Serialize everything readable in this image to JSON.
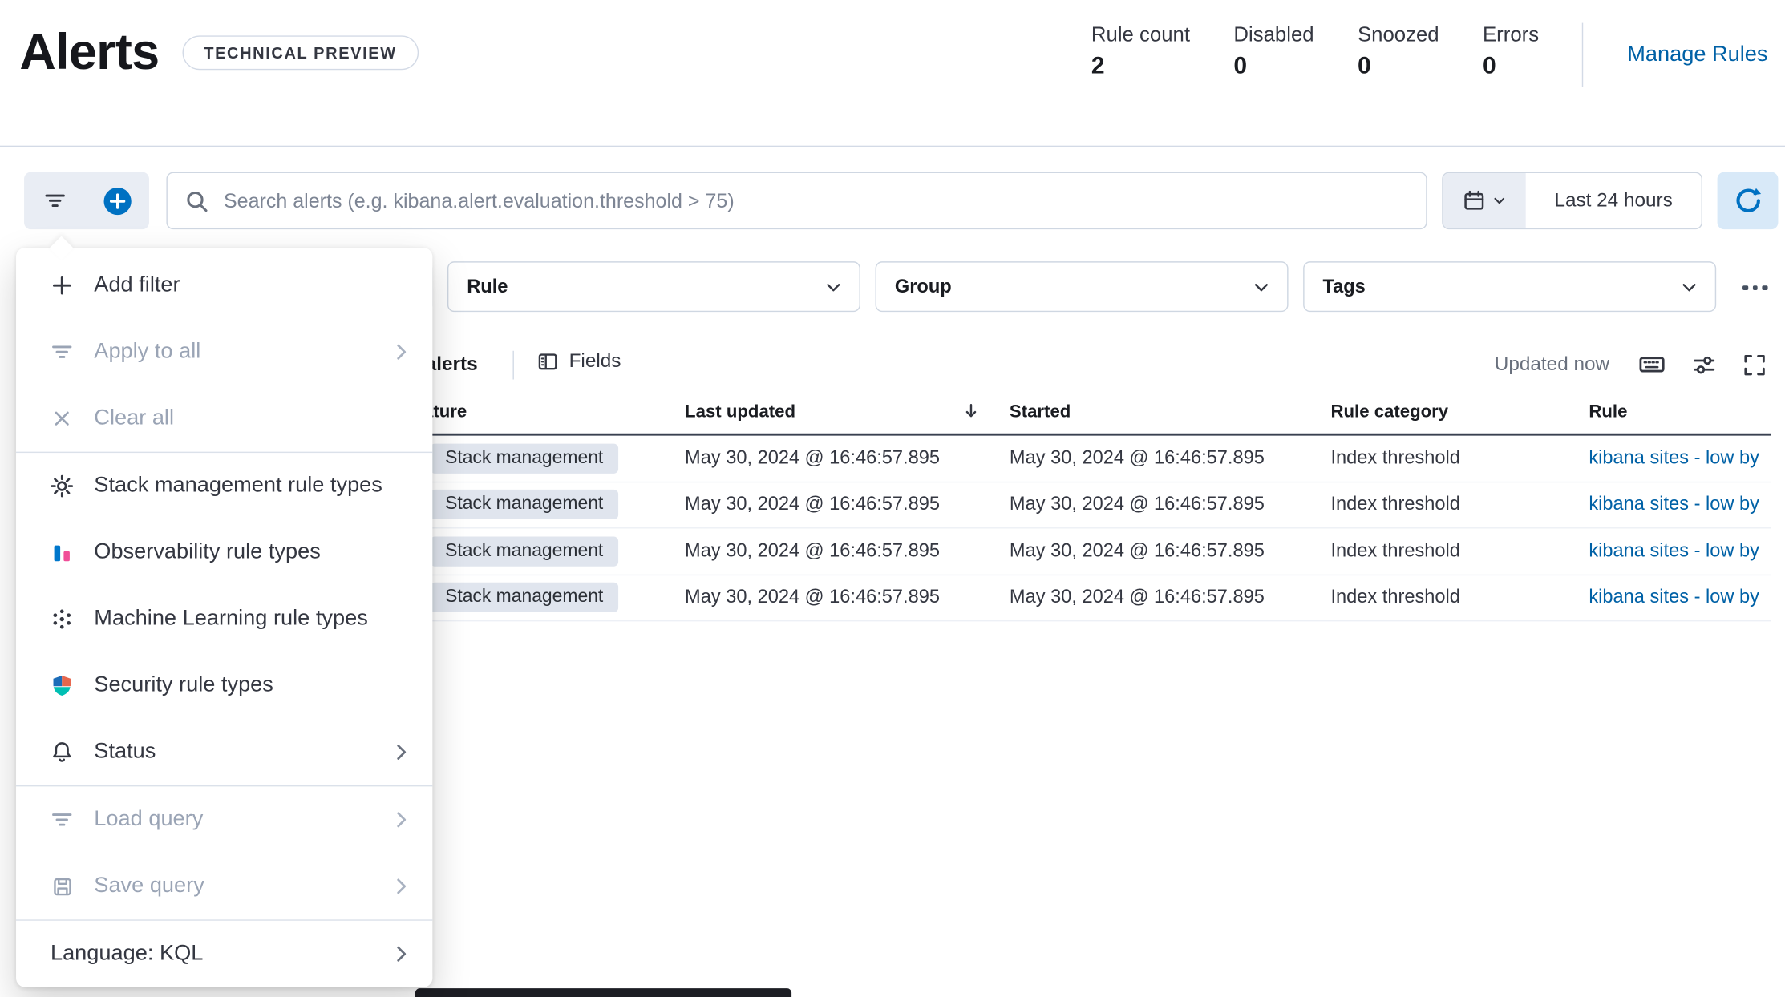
{
  "header": {
    "title": "Alerts",
    "tech_preview_badge": "TECHNICAL PREVIEW",
    "stats": [
      {
        "label": "Rule count",
        "value": "2"
      },
      {
        "label": "Disabled",
        "value": "0"
      },
      {
        "label": "Snoozed",
        "value": "0"
      },
      {
        "label": "Errors",
        "value": "0"
      }
    ],
    "manage_rules_link": "Manage Rules"
  },
  "search_bar": {
    "placeholder": "Search alerts (e.g. kibana.alert.evaluation.threshold > 75)",
    "time_range_label": "Last 24 hours"
  },
  "filter_row": {
    "selects": [
      {
        "label": "Rule"
      },
      {
        "label": "Group"
      },
      {
        "label": "Tags"
      }
    ]
  },
  "toolbar": {
    "alerts_label": "alerts",
    "fields_button": "Fields",
    "updated_text": "Updated now"
  },
  "table": {
    "columns": {
      "feature": "Feature",
      "last_updated": "Last updated",
      "started": "Started",
      "rule_category": "Rule category",
      "rule": "Rule"
    },
    "rows": [
      {
        "feature": "Stack management",
        "last_updated": "May 30, 2024 @ 16:46:57.895",
        "started": "May 30, 2024 @ 16:46:57.895",
        "rule_category": "Index threshold",
        "rule": "kibana sites - low by"
      },
      {
        "feature": "Stack management",
        "last_updated": "May 30, 2024 @ 16:46:57.895",
        "started": "May 30, 2024 @ 16:46:57.895",
        "rule_category": "Index threshold",
        "rule": "kibana sites - low by"
      },
      {
        "feature": "Stack management",
        "last_updated": "May 30, 2024 @ 16:46:57.895",
        "started": "May 30, 2024 @ 16:46:57.895",
        "rule_category": "Index threshold",
        "rule": "kibana sites - low by"
      },
      {
        "feature": "Stack management",
        "last_updated": "May 30, 2024 @ 16:46:57.895",
        "started": "May 30, 2024 @ 16:46:57.895",
        "rule_category": "Index threshold",
        "rule": "kibana sites - low by"
      }
    ]
  },
  "filter_menu": {
    "items": [
      {
        "label": "Add filter"
      },
      {
        "label": "Apply to all"
      },
      {
        "label": "Clear all"
      },
      {
        "label": "Stack management rule types"
      },
      {
        "label": "Observability rule types"
      },
      {
        "label": "Machine Learning rule types"
      },
      {
        "label": "Security rule types"
      },
      {
        "label": "Status"
      },
      {
        "label": "Load query"
      },
      {
        "label": "Save query"
      },
      {
        "label": "Language: KQL"
      }
    ]
  },
  "colors": {
    "primary": "#0071c2",
    "link": "#0061a6",
    "text": "#343741",
    "subdued": "#69707d",
    "disabled": "#9aa4b5",
    "border": "#d3dae6",
    "badge_bg": "#e0e5ee"
  }
}
